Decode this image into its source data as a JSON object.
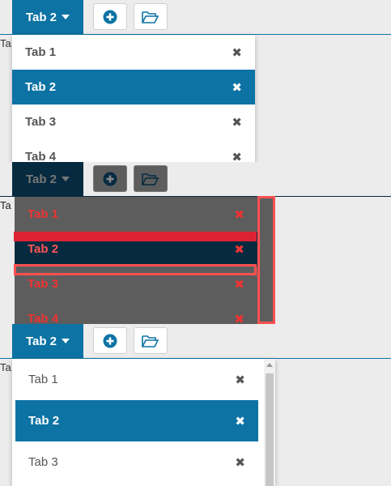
{
  "toolbar": {
    "active_tab": "Tab 2",
    "add_icon": "plus-circle-icon",
    "open_icon": "folder-open-icon"
  },
  "background_text": "Ta",
  "menu": {
    "items": [
      {
        "label": "Tab 1"
      },
      {
        "label": "Tab 2",
        "selected": true
      },
      {
        "label": "Tab 3"
      },
      {
        "label": "Tab 4"
      }
    ],
    "close_glyph": "✖"
  },
  "colors": {
    "accent": "#0c73a4",
    "diff_red": "#ff5050"
  }
}
